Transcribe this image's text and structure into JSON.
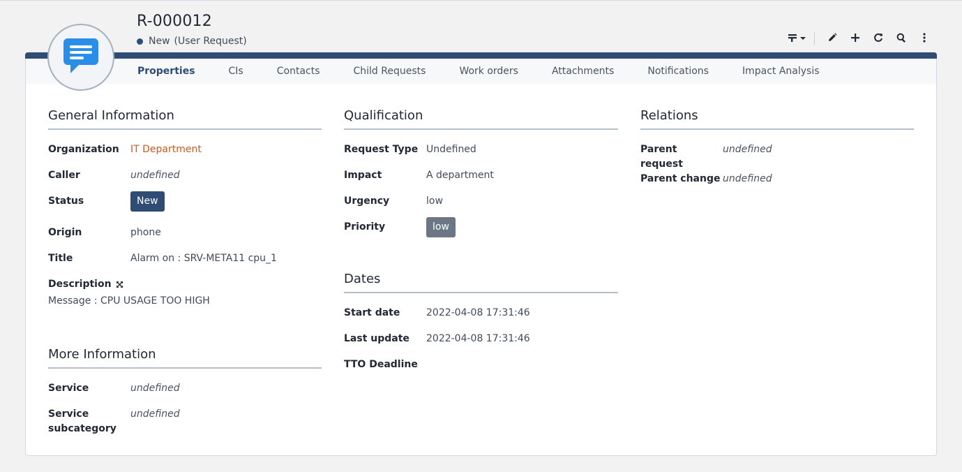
{
  "header": {
    "title": "R-000012",
    "status_label": "New",
    "status_type": "(User Request)",
    "status_color": "#2e4e7a",
    "avatar_icon": "chat-message-icon"
  },
  "toolbar": {
    "icons": [
      "transitions-dropdown-icon",
      "pencil-icon",
      "plus-icon",
      "refresh-icon",
      "search-icon",
      "more-vertical-icon"
    ]
  },
  "tabs": [
    {
      "label": "Properties",
      "active": true
    },
    {
      "label": "CIs"
    },
    {
      "label": "Contacts"
    },
    {
      "label": "Child Requests"
    },
    {
      "label": "Work orders"
    },
    {
      "label": "Attachments"
    },
    {
      "label": "Notifications"
    },
    {
      "label": "Impact Analysis"
    }
  ],
  "general": {
    "title": "General Information",
    "organization": {
      "label": "Organization",
      "value": "IT Department"
    },
    "caller": {
      "label": "Caller",
      "value": "undefined"
    },
    "status": {
      "label": "Status",
      "value": "New"
    },
    "origin": {
      "label": "Origin",
      "value": "phone"
    },
    "title_field": {
      "label": "Title",
      "value": "Alarm on : SRV-META11 cpu_1"
    },
    "description": {
      "label": "Description",
      "value": "Message : CPU USAGE TOO HIGH"
    }
  },
  "more": {
    "title": "More Information",
    "service": {
      "label": "Service",
      "value": "undefined"
    },
    "subcategory": {
      "label": "Service subcategory",
      "value": "undefined"
    }
  },
  "qualification": {
    "title": "Qualification",
    "request_type": {
      "label": "Request Type",
      "value": "Undefined"
    },
    "impact": {
      "label": "Impact",
      "value": "A department"
    },
    "urgency": {
      "label": "Urgency",
      "value": "low"
    },
    "priority": {
      "label": "Priority",
      "value": "low"
    }
  },
  "dates": {
    "title": "Dates",
    "start_date": {
      "label": "Start date",
      "value": "2022-04-08 17:31:46"
    },
    "last_update": {
      "label": "Last update",
      "value": "2022-04-08 17:31:46"
    },
    "tto_deadline": {
      "label": "TTO Deadline",
      "value": ""
    }
  },
  "relations": {
    "title": "Relations",
    "parent_request": {
      "label": "Parent request",
      "value": "undefined"
    },
    "parent_change": {
      "label": "Parent change",
      "value": "undefined"
    }
  },
  "colors": {
    "accent": "#2f4c75",
    "link": "#c85a22",
    "badge_low": "#6b7785"
  }
}
